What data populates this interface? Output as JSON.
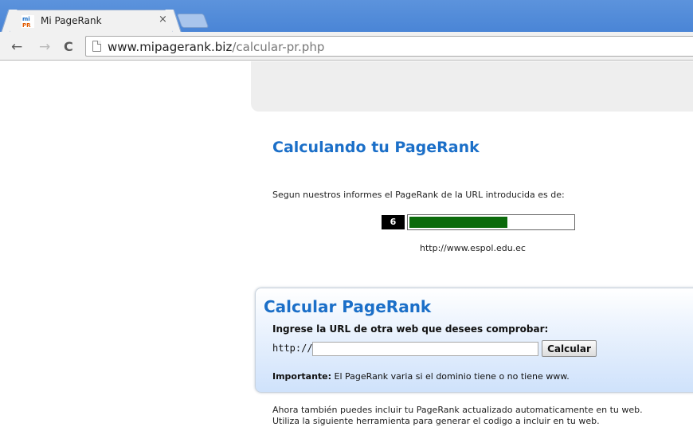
{
  "browser": {
    "tab_title": "Mi PageRank",
    "tab_close": "×",
    "url_domain": "www.mipagerank.biz",
    "url_path": "/calcular-pr.php"
  },
  "result": {
    "heading": "Calculando tu PageRank",
    "report_text": "Segun nuestros informes el PageRank de la URL introducida es de:",
    "pagerank_value": "6",
    "pagerank_fraction": 0.6,
    "checked_url": "http://www.espol.edu.ec",
    "bar_color": "#0b6a0b"
  },
  "calculator": {
    "title": "Calcular PageRank",
    "label": "Ingrese la URL de otra web que desees comprobar:",
    "prefix": "http://",
    "input_value": "",
    "button_label": "Calcular",
    "note_strong": "Importante:",
    "note_text": " El PageRank varia si el dominio tiene o no tiene www."
  },
  "footer": {
    "line1": "Ahora también puedes incluir tu PageRank actualizado automaticamente en tu web.",
    "line2": "Utiliza la siguiente herramienta para generar el codigo a incluir en tu web."
  },
  "colors": {
    "accent_blue": "#1b6fc8",
    "titlebar_blue": "#4a85d6"
  }
}
